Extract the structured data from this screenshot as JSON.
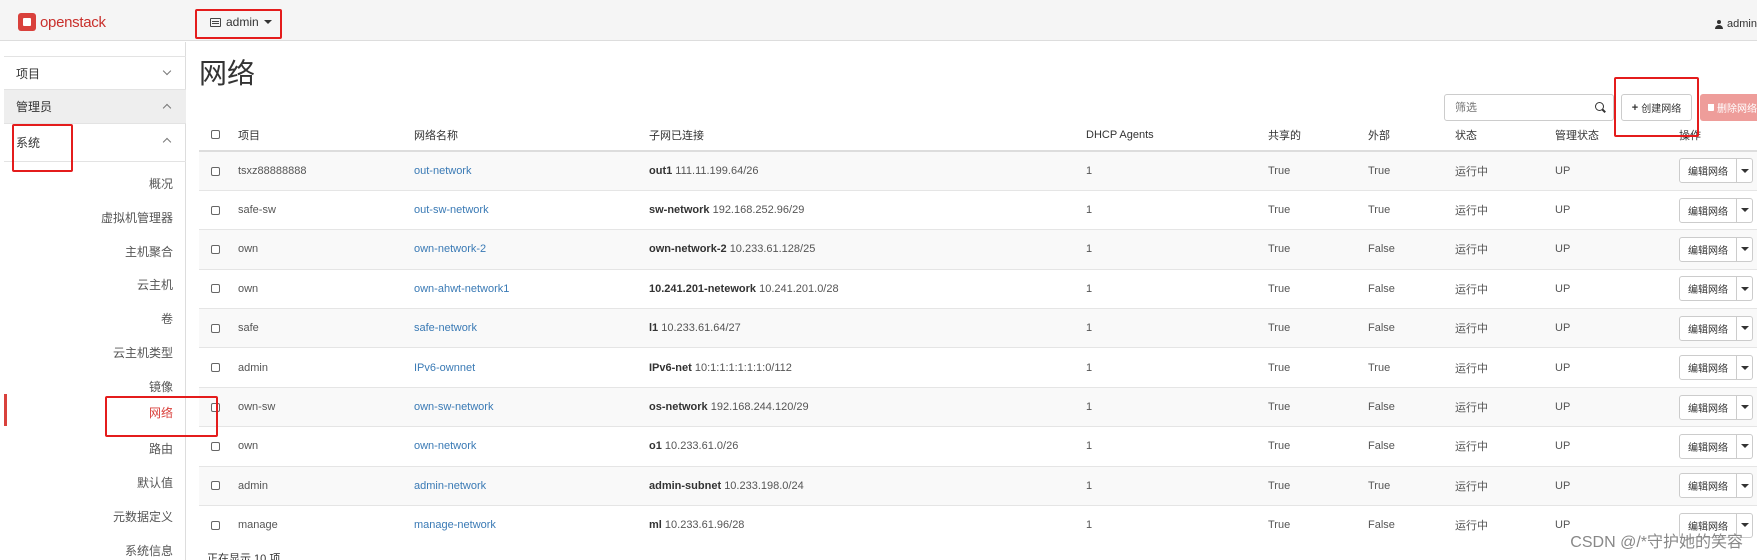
{
  "navbar": {
    "brand": "openstack",
    "project_switcher": "admin",
    "user": "admin"
  },
  "sidebar": {
    "sections": [
      {
        "label": "项目",
        "expanded": false
      },
      {
        "label": "管理员",
        "expanded": true
      },
      {
        "label": "系统",
        "expanded": true
      }
    ],
    "items": [
      {
        "label": "概况"
      },
      {
        "label": "虚拟机管理器"
      },
      {
        "label": "主机聚合"
      },
      {
        "label": "云主机"
      },
      {
        "label": "卷"
      },
      {
        "label": "云主机类型"
      },
      {
        "label": "镜像"
      },
      {
        "label": "网络",
        "active": true
      },
      {
        "label": "路由"
      },
      {
        "label": "默认值"
      },
      {
        "label": "元数据定义"
      },
      {
        "label": "系统信息"
      }
    ]
  },
  "page": {
    "title": "网络",
    "filter_placeholder": "筛选",
    "create_button": "创建网络",
    "delete_button": "删除网络",
    "footer": "正在显示 10 项"
  },
  "table": {
    "headers": [
      "项目",
      "网络名称",
      "子网已连接",
      "DHCP Agents",
      "共享的",
      "外部",
      "状态",
      "管理状态",
      "操作"
    ],
    "action_label": "编辑网络",
    "rows": [
      {
        "project": "tsxz88888888",
        "name": "out-network",
        "subnet_name": "out1",
        "subnet_cidr": "111.11.199.64/26",
        "dhcp": "1",
        "shared": "True",
        "external": "True",
        "status": "运行中",
        "admin_state": "UP"
      },
      {
        "project": "safe-sw",
        "name": "out-sw-network",
        "subnet_name": "sw-network",
        "subnet_cidr": "192.168.252.96/29",
        "dhcp": "1",
        "shared": "True",
        "external": "True",
        "status": "运行中",
        "admin_state": "UP"
      },
      {
        "project": "own",
        "name": "own-network-2",
        "subnet_name": "own-network-2",
        "subnet_cidr": "10.233.61.128/25",
        "dhcp": "1",
        "shared": "True",
        "external": "False",
        "status": "运行中",
        "admin_state": "UP"
      },
      {
        "project": "own",
        "name": "own-ahwt-network1",
        "subnet_name": "10.241.201-netework",
        "subnet_cidr": "10.241.201.0/28",
        "dhcp": "1",
        "shared": "True",
        "external": "False",
        "status": "运行中",
        "admin_state": "UP"
      },
      {
        "project": "safe",
        "name": "safe-network",
        "subnet_name": "l1",
        "subnet_cidr": "10.233.61.64/27",
        "dhcp": "1",
        "shared": "True",
        "external": "False",
        "status": "运行中",
        "admin_state": "UP"
      },
      {
        "project": "admin",
        "name": "IPv6-ownnet",
        "subnet_name": "IPv6-net",
        "subnet_cidr": "10:1:1:1:1:1:1:0/112",
        "dhcp": "1",
        "shared": "True",
        "external": "True",
        "status": "运行中",
        "admin_state": "UP"
      },
      {
        "project": "own-sw",
        "name": "own-sw-network",
        "subnet_name": "os-network",
        "subnet_cidr": "192.168.244.120/29",
        "dhcp": "1",
        "shared": "True",
        "external": "False",
        "status": "运行中",
        "admin_state": "UP"
      },
      {
        "project": "own",
        "name": "own-network",
        "subnet_name": "o1",
        "subnet_cidr": "10.233.61.0/26",
        "dhcp": "1",
        "shared": "True",
        "external": "False",
        "status": "运行中",
        "admin_state": "UP"
      },
      {
        "project": "admin",
        "name": "admin-network",
        "subnet_name": "admin-subnet",
        "subnet_cidr": "10.233.198.0/24",
        "dhcp": "1",
        "shared": "True",
        "external": "True",
        "status": "运行中",
        "admin_state": "UP"
      },
      {
        "project": "manage",
        "name": "manage-network",
        "subnet_name": "ml",
        "subnet_cidr": "10.233.61.96/28",
        "dhcp": "1",
        "shared": "True",
        "external": "False",
        "status": "运行中",
        "admin_state": "UP"
      }
    ]
  },
  "watermark": "CSDN @/*守护她的笑容",
  "colors": {
    "brand_red": "#d9413c",
    "link_blue": "#3a7ab5",
    "annotation_red": "#e41c1c",
    "delete_pink": "#ee9d9a"
  }
}
